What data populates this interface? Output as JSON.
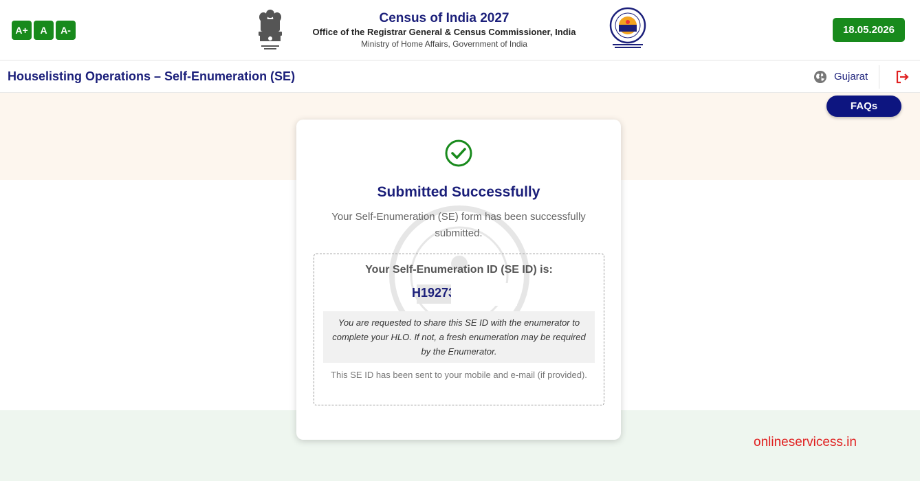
{
  "header": {
    "font_controls": [
      "A+",
      "A",
      "A-"
    ],
    "title": "Census of India 2027",
    "subtitle": "Office of the Registrar General & Census Commissioner, India",
    "ministry": "Ministry of Home Affairs, Government of India",
    "date": "18.05.2026"
  },
  "subheader": {
    "page_title": "Houselisting Operations – Self-Enumeration (SE)",
    "state": "Gujarat"
  },
  "faq_label": "FAQs",
  "card": {
    "title": "Submitted Successfully",
    "message": "Your Self-Enumeration (SE) form has been successfully submitted.",
    "id_label": "Your Self-Enumeration ID (SE ID) is:",
    "id_value": "H19273",
    "note": "You are requested to share this SE ID with the enumerator to complete your HLO. If not, a fresh enumeration may be required by the Enumerator.",
    "sms_note": "This SE ID has been sent to your mobile and e-mail (if provided)."
  },
  "footer_credit": "onlineservicess.in",
  "colors": {
    "navy": "#1b1f7a",
    "green": "#188a1c",
    "faq_bg": "#0d1580",
    "credit": "#e02020",
    "band_top": "#fdf6ee",
    "band_bottom": "#eef6ef"
  },
  "icons": {
    "emblem": "national-emblem-icon",
    "census_logo": "census-logo-icon",
    "globe": "globe-icon",
    "logout": "logout-icon",
    "check": "check-circle-icon"
  }
}
